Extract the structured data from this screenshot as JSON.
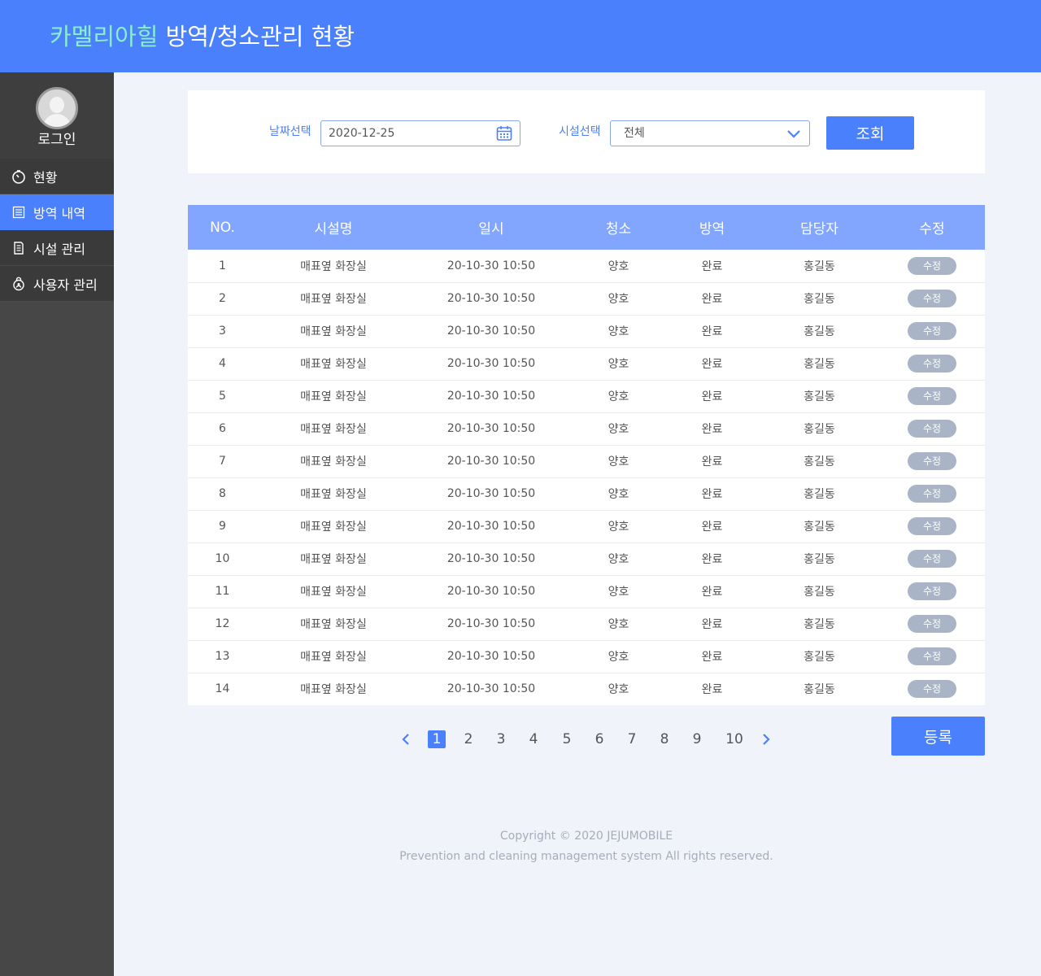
{
  "header": {
    "brand": "카멜리아힐",
    "title": " 방역/청소관리 현황"
  },
  "sidebar": {
    "login_label": "로그인",
    "items": [
      {
        "label": "현황",
        "icon": "clock-icon",
        "active": false
      },
      {
        "label": "방역 내역",
        "icon": "list-icon",
        "active": true
      },
      {
        "label": "시설 관리",
        "icon": "document-icon",
        "active": false
      },
      {
        "label": "사용자 관리",
        "icon": "user-lock-icon",
        "active": false
      }
    ]
  },
  "search": {
    "date_label": "날짜선택",
    "date_value": "2020-12-25",
    "facility_label": "시설선택",
    "facility_value": "전체",
    "search_button": "조회"
  },
  "table": {
    "columns": [
      "NO.",
      "시설명",
      "일시",
      "청소",
      "방역",
      "담당자",
      "수정"
    ],
    "rows": [
      [
        "1",
        "매표옆 화장실",
        "20-10-30 10:50",
        "양호",
        "완료",
        "홍길동",
        "수정"
      ],
      [
        "2",
        "매표옆 화장실",
        "20-10-30 10:50",
        "양호",
        "완료",
        "홍길동",
        "수정"
      ],
      [
        "3",
        "매표옆 화장실",
        "20-10-30 10:50",
        "양호",
        "완료",
        "홍길동",
        "수정"
      ],
      [
        "4",
        "매표옆 화장실",
        "20-10-30 10:50",
        "양호",
        "완료",
        "홍길동",
        "수정"
      ],
      [
        "5",
        "매표옆 화장실",
        "20-10-30 10:50",
        "양호",
        "완료",
        "홍길동",
        "수정"
      ],
      [
        "6",
        "매표옆 화장실",
        "20-10-30 10:50",
        "양호",
        "완료",
        "홍길동",
        "수정"
      ],
      [
        "7",
        "매표옆 화장실",
        "20-10-30 10:50",
        "양호",
        "완료",
        "홍길동",
        "수정"
      ],
      [
        "8",
        "매표옆 화장실",
        "20-10-30 10:50",
        "양호",
        "완료",
        "홍길동",
        "수정"
      ],
      [
        "9",
        "매표옆 화장실",
        "20-10-30 10:50",
        "양호",
        "완료",
        "홍길동",
        "수정"
      ],
      [
        "10",
        "매표옆 화장실",
        "20-10-30 10:50",
        "양호",
        "완료",
        "홍길동",
        "수정"
      ],
      [
        "11",
        "매표옆 화장실",
        "20-10-30 10:50",
        "양호",
        "완료",
        "홍길동",
        "수정"
      ],
      [
        "12",
        "매표옆 화장실",
        "20-10-30 10:50",
        "양호",
        "완료",
        "홍길동",
        "수정"
      ],
      [
        "13",
        "매표옆 화장실",
        "20-10-30 10:50",
        "양호",
        "완료",
        "홍길동",
        "수정"
      ],
      [
        "14",
        "매표옆 화장실",
        "20-10-30 10:50",
        "양호",
        "완료",
        "홍길동",
        "수정"
      ]
    ]
  },
  "pagination": {
    "pages": [
      "1",
      "2",
      "3",
      "4",
      "5",
      "6",
      "7",
      "8",
      "9",
      "10"
    ],
    "current": "1"
  },
  "register_button": "등록",
  "footer": {
    "line1": "Copyright © 2020 JEJUMOBILE",
    "line2": "Prevention and cleaning management system All rights reserved."
  },
  "colors": {
    "primary": "#4a80fb",
    "brand_text": "#88eecb",
    "table_header": "#82a5fd",
    "sidebar": "#474747"
  }
}
